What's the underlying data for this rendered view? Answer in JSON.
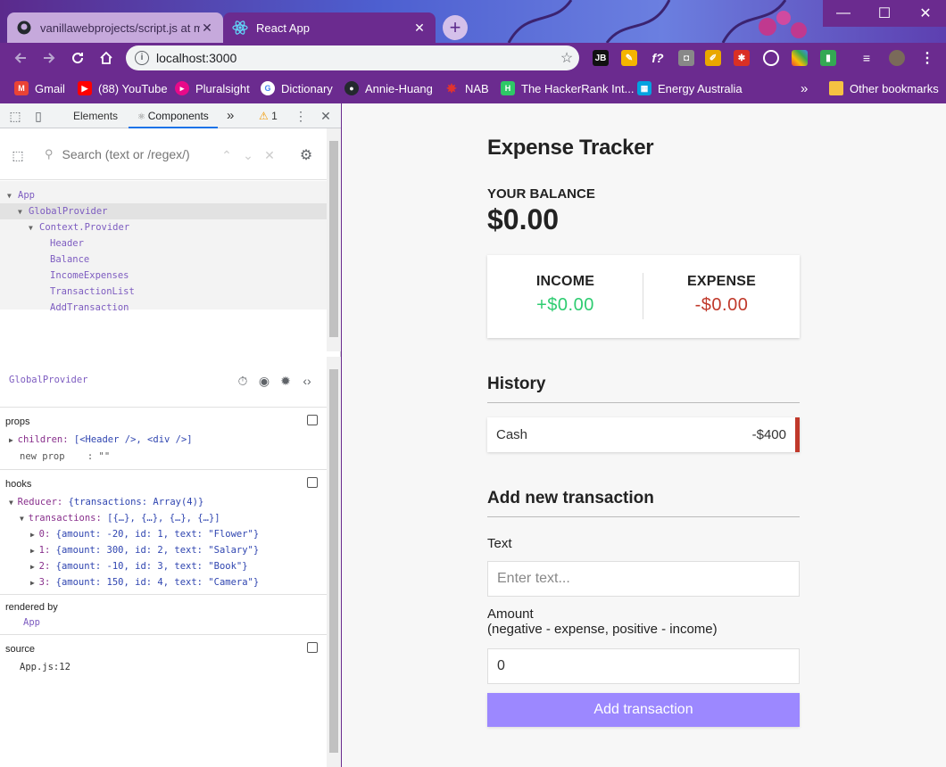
{
  "browser": {
    "tabs": [
      {
        "title": "vanillawebprojects/script.js at ma"
      },
      {
        "title": "React App"
      }
    ],
    "new_tab_label": "+",
    "window_controls": {
      "minimize": "—",
      "maximize": "☐",
      "close": "✕"
    },
    "url": "localhost:3000",
    "bookmarks": [
      {
        "label": "Gmail",
        "icon": "gmail-icon",
        "color": "#ea4335"
      },
      {
        "label": "(88) YouTube",
        "icon": "youtube-icon",
        "color": "#ff0000"
      },
      {
        "label": "Pluralsight",
        "icon": "pluralsight-icon",
        "color": "#e80a89"
      },
      {
        "label": "Dictionary",
        "icon": "google-icon",
        "color": "#4285f4"
      },
      {
        "label": "Annie-Huang",
        "icon": "github-icon",
        "color": "#24292e"
      },
      {
        "label": "NAB",
        "icon": "nab-icon",
        "color": "#c8102e"
      },
      {
        "label": "The HackerRank Int...",
        "icon": "hackerrank-icon",
        "color": "#2ec866"
      },
      {
        "label": "Energy Australia",
        "icon": "energy-australia-icon",
        "color": "#00a3e0"
      }
    ],
    "bookmarks_overflow": "»",
    "other_bookmarks": "Other bookmarks"
  },
  "devtools": {
    "tabs": {
      "elements": "Elements",
      "components": "Components",
      "more": "»",
      "warning_count": "1"
    },
    "search_placeholder": "Search (text or /regex/)",
    "tree": [
      {
        "label": "App",
        "depth": 0,
        "expanded": true
      },
      {
        "label": "GlobalProvider",
        "depth": 1,
        "expanded": true,
        "selected": true
      },
      {
        "label": "Context.Provider",
        "depth": 2,
        "expanded": true
      },
      {
        "label": "Header",
        "depth": 3
      },
      {
        "label": "Balance",
        "depth": 3
      },
      {
        "label": "IncomeExpenses",
        "depth": 3
      },
      {
        "label": "TransactionList",
        "depth": 3
      },
      {
        "label": "AddTransaction",
        "depth": 3
      }
    ],
    "selected_component": "GlobalProvider",
    "props": {
      "title": "props",
      "children_key": "children:",
      "children_val": "[<Header />, <div />]",
      "new_prop_key": "new prop",
      "new_prop_sep": ":",
      "new_prop_val": "\"\""
    },
    "hooks": {
      "title": "hooks",
      "reducer_key": "Reducer:",
      "reducer_val": "{transactions: Array(4)}",
      "transactions_key": "transactions:",
      "transactions_val": "[{…}, {…}, {…}, {…}]",
      "items": [
        {
          "index": "0:",
          "text": "{amount: -20, id: 1, text: \"Flower\"}"
        },
        {
          "index": "1:",
          "text": "{amount: 300, id: 2, text: \"Salary\"}"
        },
        {
          "index": "2:",
          "text": "{amount: -10, id: 3, text: \"Book\"}"
        },
        {
          "index": "3:",
          "text": "{amount: 150, id: 4, text: \"Camera\"}"
        }
      ]
    },
    "rendered_by": {
      "title": "rendered by",
      "value": "App"
    },
    "source": {
      "title": "source",
      "value": "App.js:12"
    }
  },
  "app": {
    "title": "Expense Tracker",
    "balance_label": "YOUR BALANCE",
    "balance": "$0.00",
    "income_label": "INCOME",
    "income": "+$0.00",
    "expense_label": "EXPENSE",
    "expense": "-$0.00",
    "history_title": "History",
    "history": [
      {
        "text": "Cash",
        "amount": "-$400"
      }
    ],
    "add_title": "Add new transaction",
    "text_label": "Text",
    "text_placeholder": "Enter text...",
    "amount_label_1": "Amount",
    "amount_label_2": "(negative - expense, positive - income)",
    "amount_value": "0",
    "add_button": "Add transaction",
    "colors": {
      "income": "#2ecc71",
      "expense": "#c0392b",
      "button": "#9c88ff"
    }
  }
}
